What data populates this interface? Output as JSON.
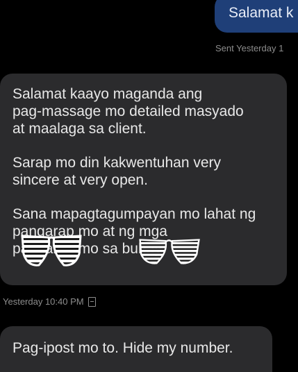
{
  "messages": {
    "sent": {
      "text": "Salamat k",
      "meta": "Sent Yesterday 1"
    },
    "received": {
      "paragraph_1": "Salamat kaayo maganda ang\npag-massage mo detailed masyado\nat maalaga sa client.",
      "paragraph_2": "Sarap mo din kakwentuhan very\nsincere at very open.",
      "paragraph_3": "Sana mapagtagumpayan mo lahat ng\npangarap mo at ng mga\npangarap mo sa buhay",
      "meta": "Yesterday 10:40 PM",
      "meta_icon": "document-icon"
    },
    "received_2": {
      "text": "Pag-ipost mo to. Hide my number."
    }
  },
  "overlays": {
    "icon": "sunglasses-sticker",
    "count": 2,
    "colors": {
      "frame": "#ffffff",
      "stripe": "#1a1a1a"
    }
  },
  "colors": {
    "background": "#000000",
    "sent_bubble": "#1f3f78",
    "received_bubble": "#2b2b2d",
    "meta_text": "#8d8d8d"
  }
}
